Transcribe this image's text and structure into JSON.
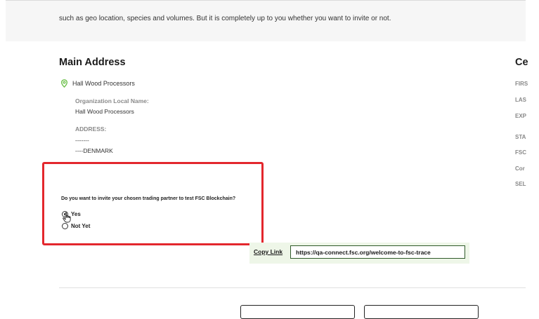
{
  "intro": {
    "text": "such as geo location, species and volumes. But it is completely up to you whether you want to invite or not."
  },
  "main_address": {
    "title": "Main Address",
    "org_name": "Hall Wood Processors",
    "local_name_label": "Organization Local Name:",
    "local_name_value": "Hall Wood Processors",
    "address_label": "ADDRESS:",
    "address_line1": "-------",
    "address_line2": "----DENMARK"
  },
  "right_column": {
    "title": "Ce",
    "labels": [
      "FIRS",
      "LAS",
      "EXP",
      "STA",
      "FSC",
      "Cor",
      "SEL"
    ]
  },
  "invite": {
    "question": "Do you want to invite your chosen trading partner to test FSC Blockchain?",
    "options": [
      {
        "label": "Yes",
        "selected": true
      },
      {
        "label": "Not Yet",
        "selected": false
      }
    ]
  },
  "copy": {
    "link_label": "Copy Link",
    "url": "https://qa-connect.fsc.org/welcome-to-fsc-trace"
  },
  "colors": {
    "highlight": "#e3272d",
    "pin": "#6cc04a",
    "copy_bg": "#eef6e8"
  }
}
